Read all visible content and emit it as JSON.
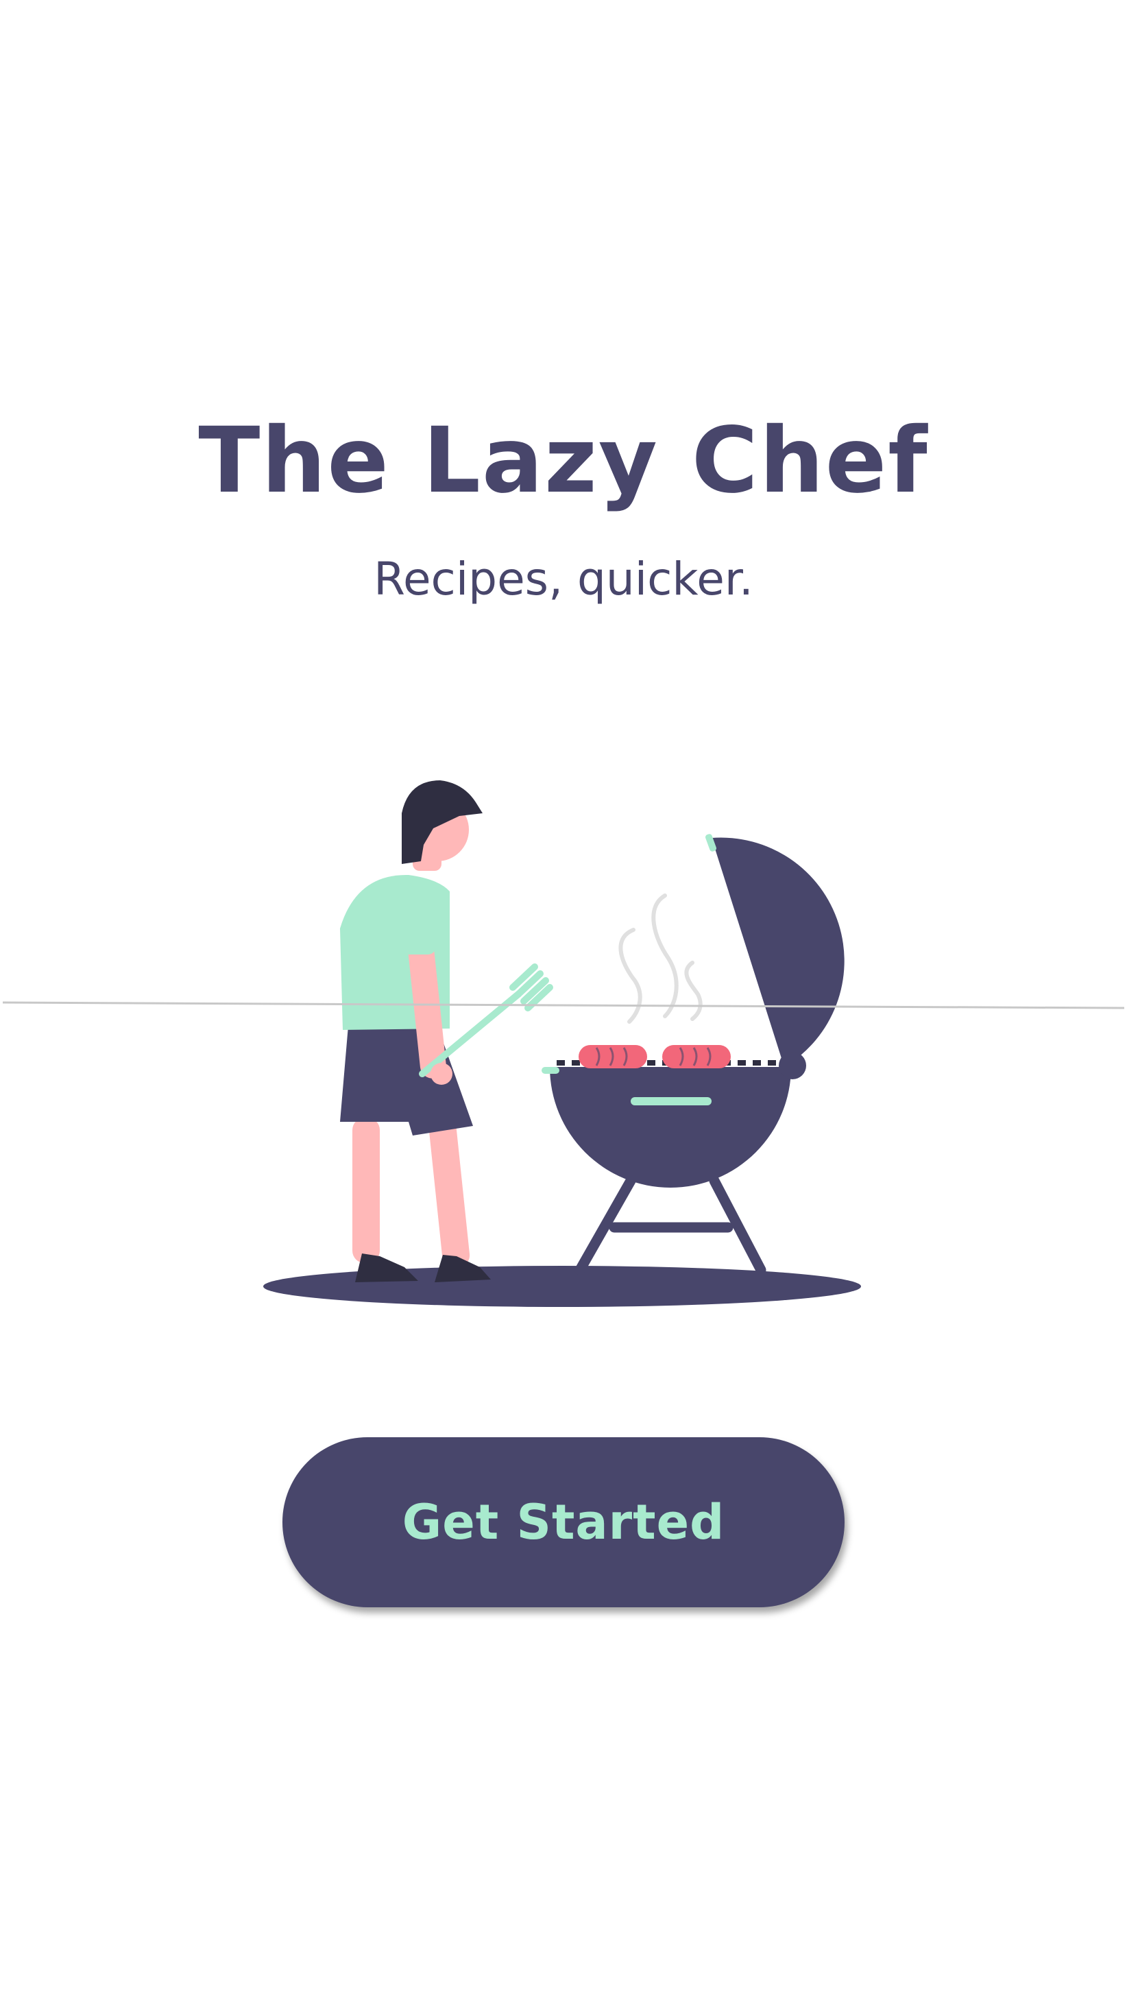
{
  "app": {
    "title": "The Lazy Chef",
    "tagline": "Recipes, quicker."
  },
  "illustration": {
    "subject": "person-grilling-at-kettle-bbq",
    "icon": "bbq-grill-illustration"
  },
  "actions": {
    "get_started_label": "Get Started"
  },
  "colors": {
    "background": "#ffffff",
    "primary": "#48466b",
    "accent": "#a8eace",
    "skin": "#ffb8b8",
    "hair": "#2f2e41",
    "sausage": "#f2677a",
    "smoke": "#e0e0e0",
    "divider": "#c8c8c8"
  }
}
